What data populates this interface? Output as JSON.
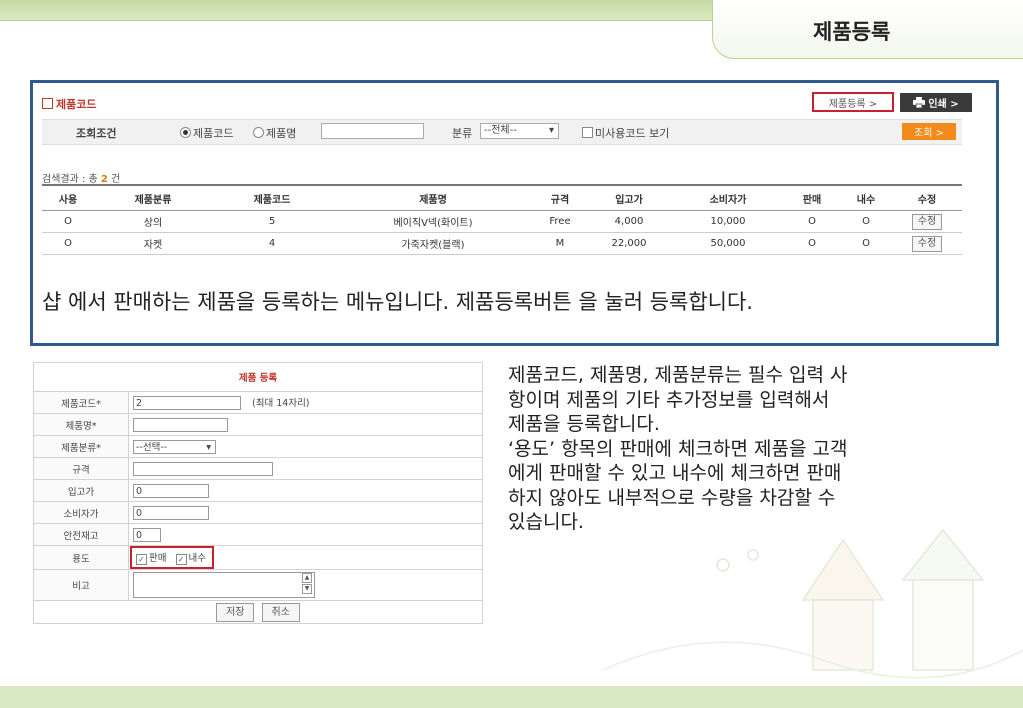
{
  "slide_title": "제품등록",
  "panel": {
    "section_title": "제품코드",
    "register_button": "제품등록 >",
    "print_button": "인쇄 >",
    "search": {
      "label": "조회조건",
      "radio_code": "제품코드",
      "radio_name": "제품명",
      "category_label": "분류",
      "category_value": "--전체--",
      "unused_checkbox": "미사용코드 보기",
      "search_button": "조회 >"
    },
    "result_prefix": "검색결과 : 총",
    "result_count": "2",
    "result_suffix": "건",
    "table": {
      "headers": [
        "사용",
        "제품분류",
        "제품코드",
        "제품명",
        "규격",
        "입고가",
        "소비자가",
        "판매",
        "내수",
        "수정"
      ],
      "rows": [
        [
          "O",
          "상의",
          "5",
          "베이직V넥(화이트)",
          "Free",
          "4,000",
          "10,000",
          "O",
          "O",
          "수정"
        ],
        [
          "O",
          "자켓",
          "4",
          "가죽자켓(블랙)",
          "M",
          "22,000",
          "50,000",
          "O",
          "O",
          "수정"
        ]
      ]
    },
    "description": "샵 에서 판매하는 제품을 등록하는 메뉴입니다. 제품등록버튼 을 눌러 등록합니다."
  },
  "form": {
    "title": "제품 등록",
    "fields": {
      "code_label": "제품코드*",
      "code_value": "2",
      "code_hint": "(최대 14자리)",
      "name_label": "제품명*",
      "category_label": "제품분류*",
      "category_value": "--선택--",
      "spec_label": "규격",
      "cost_label": "입고가",
      "cost_value": "0",
      "price_label": "소비자가",
      "price_value": "0",
      "stock_label": "안전재고",
      "stock_value": "0",
      "use_label": "용도",
      "use_sale": "판매",
      "use_internal": "내수",
      "note_label": "비고"
    },
    "save_button": "저장",
    "cancel_button": "취소"
  },
  "explanation": [
    "제품코드, 제품명, 제품분류는 필수 입력 사",
    "항이며 제품의 기타 추가정보를 입력해서",
    "제품을 등록합니다.",
    "‘용도’ 항목의 판매에 체크하면 제품을 고객",
    "에게 판매할 수 있고 내수에 체크하면 판매",
    "하지 않아도 내부적으로 수량을 차감할 수",
    "있습니다."
  ]
}
